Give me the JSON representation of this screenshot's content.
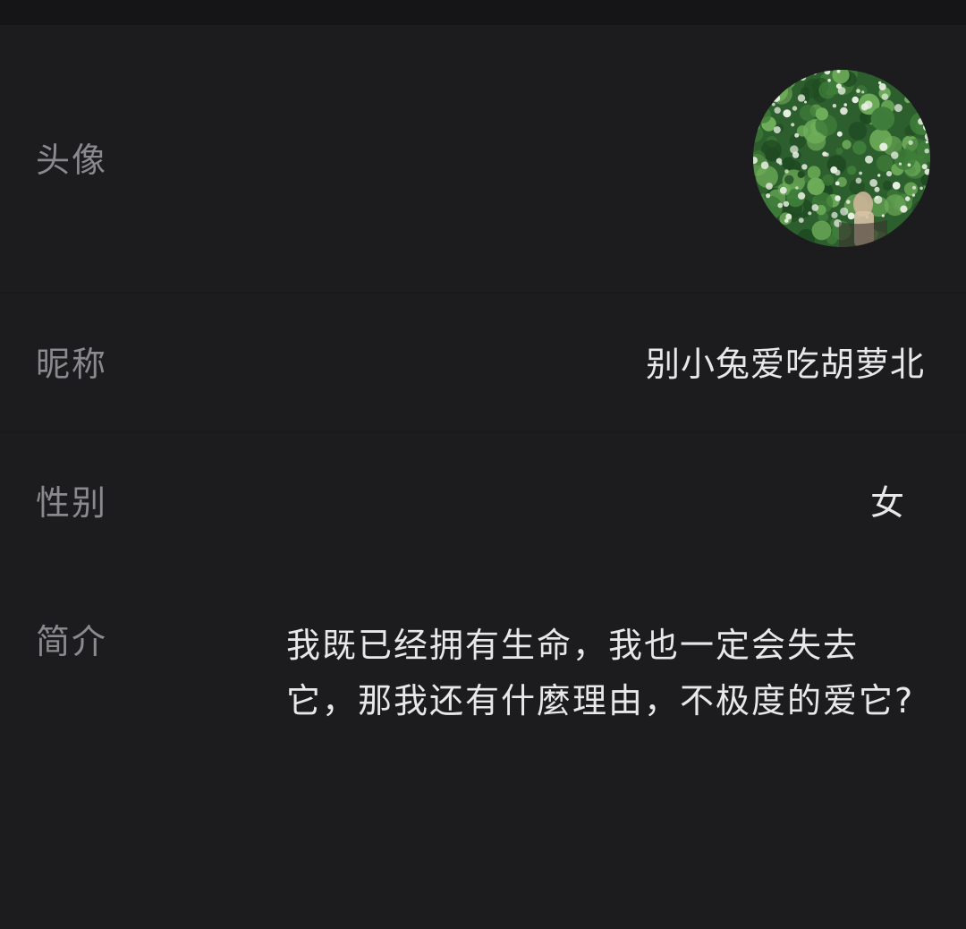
{
  "profile": {
    "avatar": {
      "label": "头像",
      "image": "avatar-photo-white-flowers-bush",
      "colors": {
        "foliage_dark": "#1f4a22",
        "foliage_mid": "#3f7d3a",
        "foliage_light": "#6fae5a",
        "flower": "#e9efe4",
        "figure": "#cdb59a"
      }
    },
    "nickname": {
      "label": "昵称",
      "value": "别小兔爱吃胡萝北"
    },
    "gender": {
      "label": "性别",
      "value": "女"
    },
    "bio": {
      "label": "简介",
      "value": "我既已经拥有生命，我也一定会失去它，那我还有什麼理由，不极度的爱它?"
    }
  }
}
